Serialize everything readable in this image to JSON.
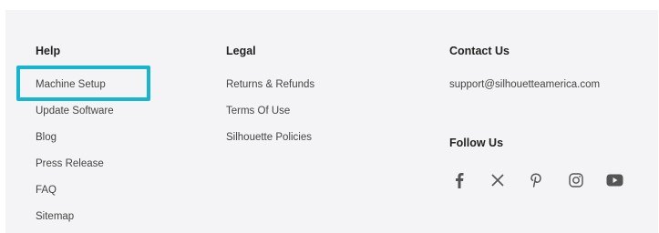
{
  "help": {
    "heading": "Help",
    "links": [
      "Machine Setup",
      "Update Software",
      "Blog",
      "Press Release",
      "FAQ",
      "Sitemap"
    ]
  },
  "legal": {
    "heading": "Legal",
    "links": [
      "Returns & Refunds",
      "Terms Of Use",
      "Silhouette Policies"
    ]
  },
  "contact": {
    "heading": "Contact Us",
    "email": "support@silhouetteamerica.com"
  },
  "follow": {
    "heading": "Follow Us",
    "icons": [
      "facebook-icon",
      "x-icon",
      "pinterest-icon",
      "instagram-icon",
      "youtube-icon"
    ]
  },
  "highlight": {
    "target": "Machine Setup",
    "color": "#16b6d2"
  },
  "colors": {
    "footer_bg": "#f4f4f6",
    "text": "#444444",
    "heading": "#222222",
    "icon": "#555555"
  }
}
